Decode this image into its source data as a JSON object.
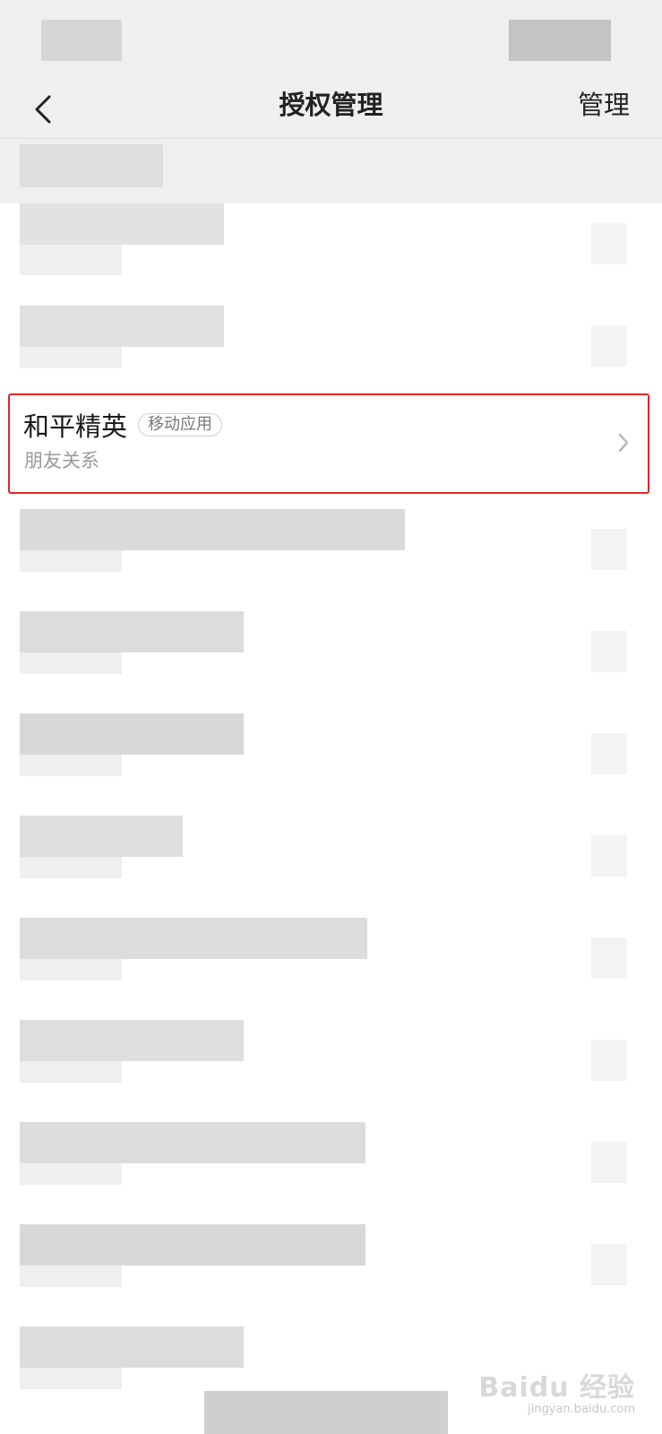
{
  "nav": {
    "back_icon": "chevron-left-icon",
    "title": "授权管理",
    "manage_label": "管理"
  },
  "highlighted_item": {
    "name": "和平精英",
    "tag": "移动应用",
    "permission": "朋友关系",
    "chevron_icon": "chevron-right-icon"
  },
  "watermark": {
    "brand": "Baidu 经验",
    "url": "jingyan.baidu.com"
  },
  "colors": {
    "highlight_border": "#e02626",
    "nav_background": "#efefef",
    "secondary_text": "#9a9a9a"
  }
}
